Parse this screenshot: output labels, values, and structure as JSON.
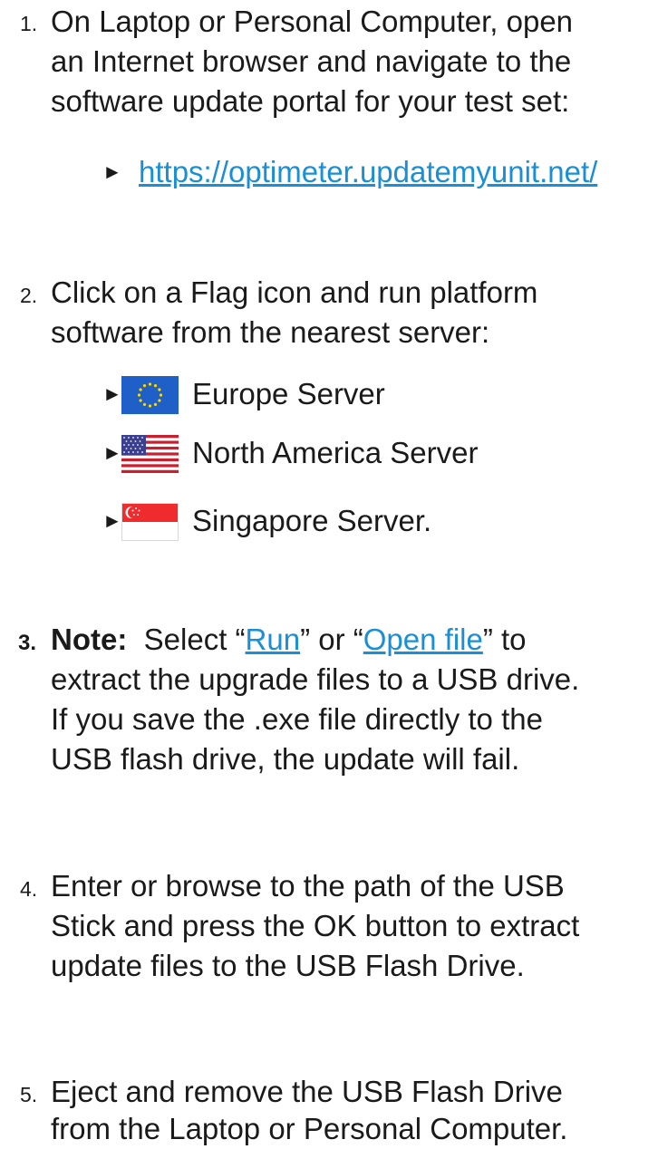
{
  "steps": [
    {
      "number": "1.",
      "lines": [
        "On Laptop or Personal Computer, open",
        "an Internet browser and navigate to the",
        "software update portal for your test set:"
      ],
      "link": "https://optimeter.updatemyunit.net/"
    },
    {
      "number": "2.",
      "lines": [
        "Click on a Flag icon and run platform",
        "software from the nearest server:"
      ],
      "servers": [
        {
          "flag": "eu-flag-icon",
          "label": "Europe Server"
        },
        {
          "flag": "us-flag-icon",
          "label": "North America Server"
        },
        {
          "flag": "sg-flag-icon",
          "label": "Singapore Server."
        }
      ]
    },
    {
      "number": "3.",
      "note_label": "Note:",
      "line1_pre": "  Select “",
      "run_link": "Run",
      "line1_mid": "” or “",
      "open_link": "Open file",
      "line1_post": "” to",
      "lines": [
        "extract the upgrade files to a USB drive.",
        "If you save the .exe file directly to the",
        "USB flash drive, the update will fail."
      ]
    },
    {
      "number": "4.",
      "lines": [
        "Enter or browse to the path of the USB",
        "Stick and press the OK button to extract",
        "update files to the USB Flash Drive."
      ]
    },
    {
      "number": "5.",
      "lines": [
        "Eject and remove the USB Flash Drive",
        "from the Laptop or Personal Computer."
      ]
    }
  ],
  "bullet_glyph": "►",
  "colors": {
    "text": "#1a1a1a",
    "link": "#1a8fd6"
  }
}
